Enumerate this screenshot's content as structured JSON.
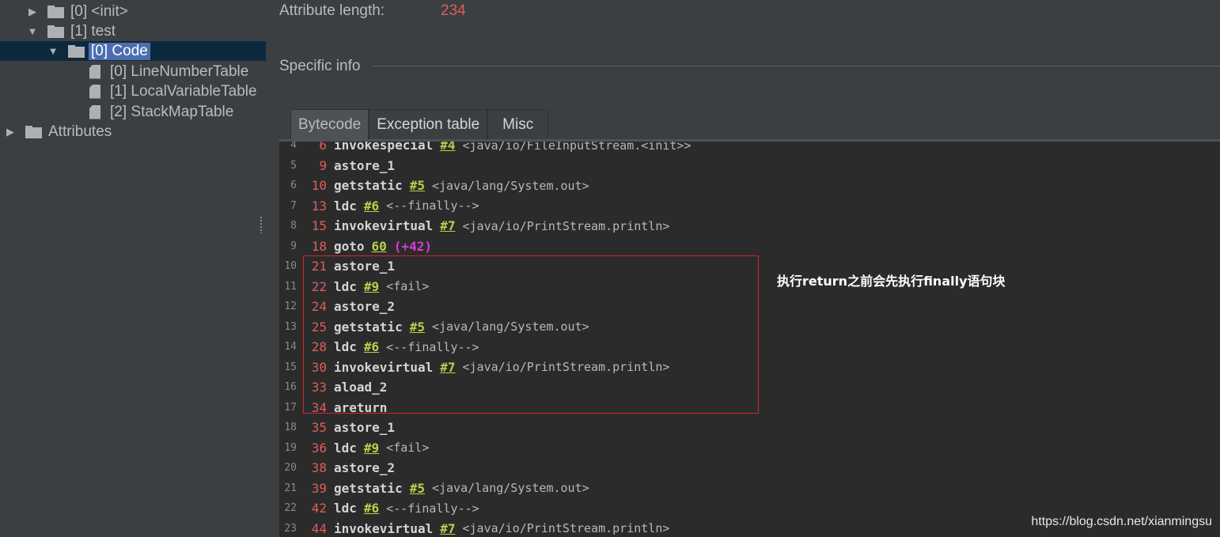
{
  "tree": {
    "items": [
      {
        "label": "[0] <init>",
        "arrow": "▶",
        "icon": "folder-icon"
      },
      {
        "label": "[1] test",
        "arrow": "▼",
        "icon": "folder-icon"
      },
      {
        "label": "[0] Code",
        "arrow": "▼",
        "icon": "folder-icon"
      },
      {
        "label": "[0] LineNumberTable",
        "icon": "file-icon"
      },
      {
        "label": "[1] LocalVariableTable",
        "icon": "file-icon"
      },
      {
        "label": "[2] StackMapTable",
        "icon": "file-icon"
      },
      {
        "label": "Attributes",
        "arrow": "▶",
        "icon": "folder-icon"
      }
    ]
  },
  "details": {
    "attribute_length_label": "Attribute length:",
    "attribute_length_value": "234",
    "specific_info_label": "Specific info"
  },
  "tabs": [
    {
      "label": "Bytecode"
    },
    {
      "label": "Exception table"
    },
    {
      "label": "Misc"
    }
  ],
  "bytecode": {
    "lines": [
      {
        "ln": "4",
        "off": "6",
        "op": "invokespecial",
        "ref": "#4",
        "cmt": "<java/io/FileInputStream.<init>>"
      },
      {
        "ln": "5",
        "off": "9",
        "op": "astore_1"
      },
      {
        "ln": "6",
        "off": "10",
        "op": "getstatic",
        "ref": "#5",
        "cmt": "<java/lang/System.out>"
      },
      {
        "ln": "7",
        "off": "13",
        "op": "ldc",
        "ref": "#6",
        "cmt": "<--finally-->"
      },
      {
        "ln": "8",
        "off": "15",
        "op": "invokevirtual",
        "ref": "#7",
        "cmt": "<java/io/PrintStream.println>"
      },
      {
        "ln": "9",
        "off": "18",
        "op": "goto",
        "ref": "60",
        "jmp": "(+42)"
      },
      {
        "ln": "10",
        "off": "21",
        "op": "astore_1"
      },
      {
        "ln": "11",
        "off": "22",
        "op": "ldc",
        "ref": "#9",
        "cmt": "<fail>"
      },
      {
        "ln": "12",
        "off": "24",
        "op": "astore_2"
      },
      {
        "ln": "13",
        "off": "25",
        "op": "getstatic",
        "ref": "#5",
        "cmt": "<java/lang/System.out>"
      },
      {
        "ln": "14",
        "off": "28",
        "op": "ldc",
        "ref": "#6",
        "cmt": "<--finally-->"
      },
      {
        "ln": "15",
        "off": "30",
        "op": "invokevirtual",
        "ref": "#7",
        "cmt": "<java/io/PrintStream.println>"
      },
      {
        "ln": "16",
        "off": "33",
        "op": "aload_2"
      },
      {
        "ln": "17",
        "off": "34",
        "op": "areturn"
      },
      {
        "ln": "18",
        "off": "35",
        "op": "astore_1"
      },
      {
        "ln": "19",
        "off": "36",
        "op": "ldc",
        "ref": "#9",
        "cmt": "<fail>"
      },
      {
        "ln": "20",
        "off": "38",
        "op": "astore_2"
      },
      {
        "ln": "21",
        "off": "39",
        "op": "getstatic",
        "ref": "#5",
        "cmt": "<java/lang/System.out>"
      },
      {
        "ln": "22",
        "off": "42",
        "op": "ldc",
        "ref": "#6",
        "cmt": "<--finally-->"
      },
      {
        "ln": "23",
        "off": "44",
        "op": "invokevirtual",
        "ref": "#7",
        "cmt": "<java/io/PrintStream.println>"
      }
    ]
  },
  "annotation": "执行return之前会先执行finally语句块",
  "watermark": "https://blog.csdn.net/xianmingsu",
  "colors": {
    "background": "#3c3f41",
    "code_background": "#2b2b2b",
    "offset": "#e05c5c",
    "reference": "#b8d14a",
    "jump": "#d83bd8",
    "highlight_border": "#d0262f",
    "selection": "#4b6eaf"
  }
}
